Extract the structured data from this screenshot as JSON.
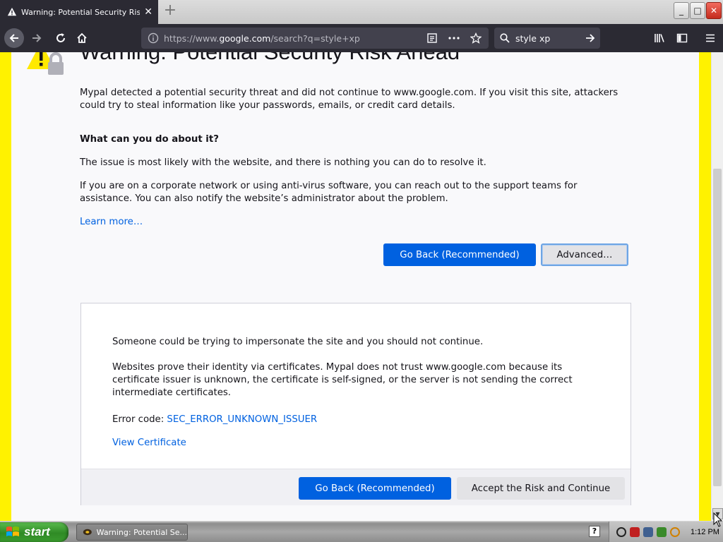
{
  "browser": {
    "tab": {
      "title": "Warning: Potential Security Risk A",
      "close": "✕"
    },
    "new_tab": "+",
    "window_buttons": {
      "minimize": "_",
      "maximize": "□",
      "close": "✕"
    },
    "url": {
      "prefix": "https://www.",
      "host": "google.com",
      "path": "/search?q=style+xp"
    },
    "search": {
      "value": "style xp"
    }
  },
  "page": {
    "title": "Warning: Potential Security Risk Ahead",
    "intro": "Mypal detected a potential security threat and did not continue to www.google.com. If you visit this site, attackers could try to steal information like your passwords, emails, or credit card details.",
    "what_heading": "What can you do about it?",
    "issue": "The issue is most likely with the website, and there is nothing you can do to resolve it.",
    "corporate": "If you are on a corporate network or using anti-virus software, you can reach out to the support teams for assistance. You can also notify the website’s administrator about the problem.",
    "learn_more": "Learn more…",
    "go_back": "Go Back (Recommended)",
    "advanced": "Advanced…"
  },
  "advanced_panel": {
    "impersonate": "Someone could be trying to impersonate the site and you should not continue.",
    "websites": "Websites prove their identity via certificates. Mypal does not trust www.google.com because its certificate issuer is unknown, the certificate is self-signed, or the server is not sending the correct intermediate certificates.",
    "error_code_label": "Error code: ",
    "error_code": "SEC_ERROR_UNKNOWN_ISSUER",
    "view_certificate": "View Certificate",
    "go_back": "Go Back (Recommended)",
    "accept": "Accept the Risk and Continue"
  },
  "taskbar": {
    "start": "start",
    "task_item": "Warning: Potential Se...",
    "help": "?",
    "clock": "1:12 PM"
  },
  "colors": {
    "accent": "#0061e0",
    "border_highlight": "#fff200",
    "toolbar": "#2b2a33"
  }
}
